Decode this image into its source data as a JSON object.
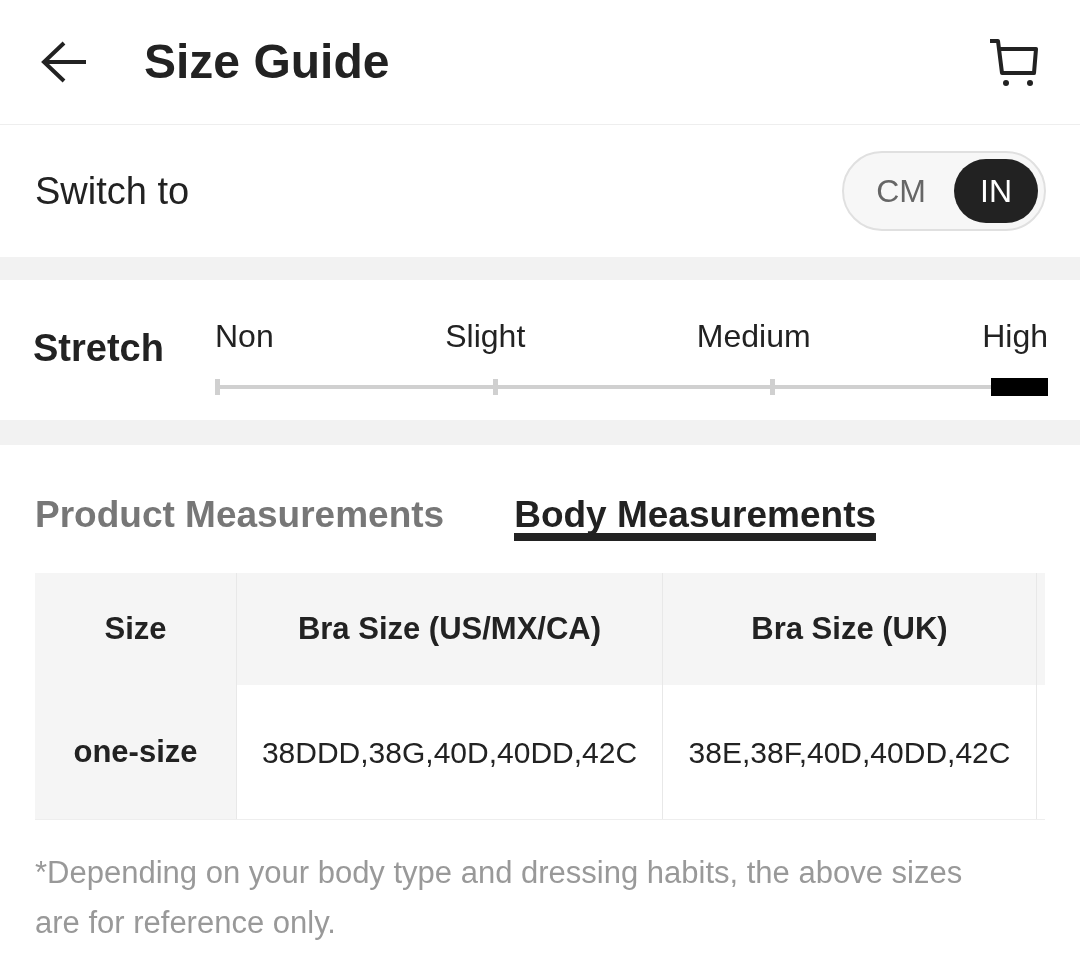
{
  "header": {
    "title": "Size Guide"
  },
  "unit_switch": {
    "label": "Switch to",
    "options": [
      {
        "label": "CM",
        "selected": false
      },
      {
        "label": "IN",
        "selected": true
      }
    ]
  },
  "stretch": {
    "label": "Stretch",
    "options": [
      {
        "label": "Non",
        "selected": false
      },
      {
        "label": "Slight",
        "selected": false
      },
      {
        "label": "Medium",
        "selected": false
      },
      {
        "label": "High",
        "selected": true
      }
    ]
  },
  "tabs": [
    {
      "label": "Product Measurements",
      "selected": false
    },
    {
      "label": "Body Measurements",
      "selected": true
    }
  ],
  "table": {
    "columns": [
      "Size",
      "Bra Size (US/MX/CA)",
      "Bra Size (UK)"
    ],
    "rows": [
      [
        "one-size",
        "38DDD,38G,40D,40DD,42C",
        "38E,38F,40D,40DD,42C"
      ]
    ]
  },
  "footnote": "*Depending on your body type and dressing habits, the above sizes are for reference only."
}
